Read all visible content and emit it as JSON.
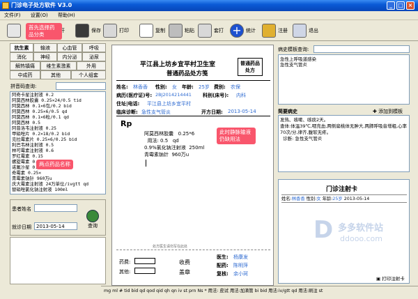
{
  "window": {
    "title": "门诊电子处方软件 V3.0"
  },
  "menu": [
    "文件(F)",
    "设置(O)",
    "帮助(H)"
  ],
  "toolbar": [
    {
      "label": "开",
      "icon": "tool-icon"
    },
    {
      "label": "保存",
      "icon": "save-icon"
    },
    {
      "label": "打印",
      "icon": "printer-icon"
    },
    {
      "label": "复制",
      "icon": "copy-icon"
    },
    {
      "label": "粘贴",
      "icon": "paste-icon"
    },
    {
      "label": "套打",
      "icon": "print-template-icon"
    },
    {
      "label": "统计",
      "icon": "add-stats-icon"
    },
    {
      "label": "注册",
      "icon": "key-icon"
    },
    {
      "label": "退出",
      "icon": "plane-exit-icon"
    }
  ],
  "category_tabs": [
    [
      "抗生素",
      "输液",
      "心血管",
      "呼吸"
    ],
    [
      "消化",
      "神经",
      "内分泌",
      "泌尿"
    ],
    [
      "解热镇痛",
      "维生素激素",
      "外用"
    ],
    [
      "中成药",
      "其他",
      "个人组套"
    ]
  ],
  "search": {
    "label": "拼音码查询:"
  },
  "drug_list": [
    "阿奇卡星注射液  0.2",
    "阿莫西林胶囊 0.25×24/0.5 tid",
    "阿莫西林  0.1×6包/0.2 bid",
    "阿莫西林  0.25×6/0.5 qd",
    "阿莫西林  0.1×6粒/0.1 qd",
    "阿莫西林  0.5",
    "阿昔洛韦注射液  0.25",
    "甲硝唑片  0.2×18/0.2 bid",
    "克拉霉素片  0.25×6/0.25 bid",
    "利巴韦林注射液  0.5",
    "林可霉素注射液  0.6",
    "罗红霉素  0.15",
    "螺旋霉素  0.2",
    "诺氟沙星  0.1×12/0.4",
    "奇霉素  0.25×",
    "青霉素钠针  960万u",
    "庆大霉素注射液  24万单位/ivgtt qd",
    "替硝唑氯化钠注射液  100ml"
  ],
  "patient_query": {
    "name_label": "患者姓名",
    "date_label": "就诊日期",
    "date_value": "2013-05-14",
    "button": "查询"
  },
  "rx": {
    "hospital": "平江县上坊乡宜平村卫生室",
    "subtitle": "普通药品处方笺",
    "badge": "普通药品处方",
    "name_label": "姓名:",
    "name": "林香香",
    "sex_label": "性别:",
    "sex": "女",
    "age_label": "年龄:",
    "age": "25岁",
    "fee_label": "费别:",
    "fee": "农保",
    "case_label": "病历(医疗证)号:",
    "case_no": "2BJ2014214441",
    "ward_label": "科别(床号):",
    "ward": "内科",
    "addr_label": "住址|电话:",
    "addr": "平江县上坊乡宜平村",
    "diag_label": "临床诊断:",
    "diagnosis": "急性支气管炎",
    "date_label": "开方日期:",
    "date": "2013-05-14",
    "rp": "Rp",
    "lines": [
      "阿莫西林胶囊   0.25*6",
      "  用法: 0.5   qd",
      "0.9%氯化钠注射液  250ml",
      "青霉素钠针  960万u"
    ],
    "note": "处方医生请勿写在此处",
    "fee_sign": "药费:",
    "other": "其他:",
    "receive": "收费",
    "stamp": "盖章",
    "doctor_label": "医生:",
    "doctor": "杨康发",
    "dispense_label": "配药:",
    "dispenser": "陈明萍",
    "check_label": "复核:",
    "checker": "余小珂"
  },
  "right": {
    "template_label": "病史模板查询:",
    "templates": [
      "急性上呼吸道感染",
      "急性支气管炎"
    ],
    "history_label": "简要病史",
    "add_history": "添加到模板",
    "history_text": "发热、咳嗽、咳痰2天。\n查体:体温39℃,咽充血,两侧扁桃体无肿大,两肺呼吸音增粗,心率70次/分,律齐,腹软无疼。\n  诊断: 急性支气管炎",
    "card_title": "门诊注射卡",
    "card_row": {
      "name_label": "姓名:",
      "name": "林香香",
      "sex_label": "性别:",
      "sex": "女",
      "age_label": "年龄:",
      "age": "25岁",
      "date": "2013-05-14"
    },
    "print_card": "打印注射卡"
  },
  "callouts": {
    "c1": "首先选择药品分类",
    "c2": "两点药品名称",
    "c3": "此时静脉输液仍缺用法"
  },
  "statusbar": "mg ml # tid bid qd qod qid qh qn iv st prn Ns * 用法: 皮试 用法:加滴管 bi bid 用法:iv/gtt qd 用法:刷注 st",
  "watermark": {
    "brand": "多多软件站",
    "url": "ddooo.com"
  }
}
